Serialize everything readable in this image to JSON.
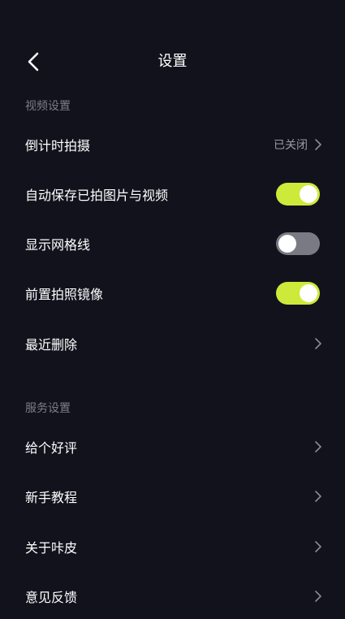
{
  "header": {
    "title": "设置"
  },
  "sections": {
    "video": {
      "title": "视频设置",
      "countdown": {
        "label": "倒计时拍摄",
        "value": "已关闭"
      },
      "autosave": {
        "label": "自动保存已拍图片与视频",
        "on": true
      },
      "grid": {
        "label": "显示网格线",
        "on": false
      },
      "mirror": {
        "label": "前置拍照镜像",
        "on": true
      },
      "deleted": {
        "label": "最近删除"
      }
    },
    "service": {
      "title": "服务设置",
      "rate": {
        "label": "给个好评"
      },
      "tutorial": {
        "label": "新手教程"
      },
      "about": {
        "label": "关于咔皮"
      },
      "feedback": {
        "label": "意见反馈"
      }
    }
  },
  "colors": {
    "background": "#12121d",
    "accent": "#cdea3a",
    "toggle_off": "#7a7a84",
    "muted_text": "#7d7d88"
  },
  "icons": {
    "back": "chevron-left-icon",
    "row_arrow": "chevron-right-icon"
  }
}
